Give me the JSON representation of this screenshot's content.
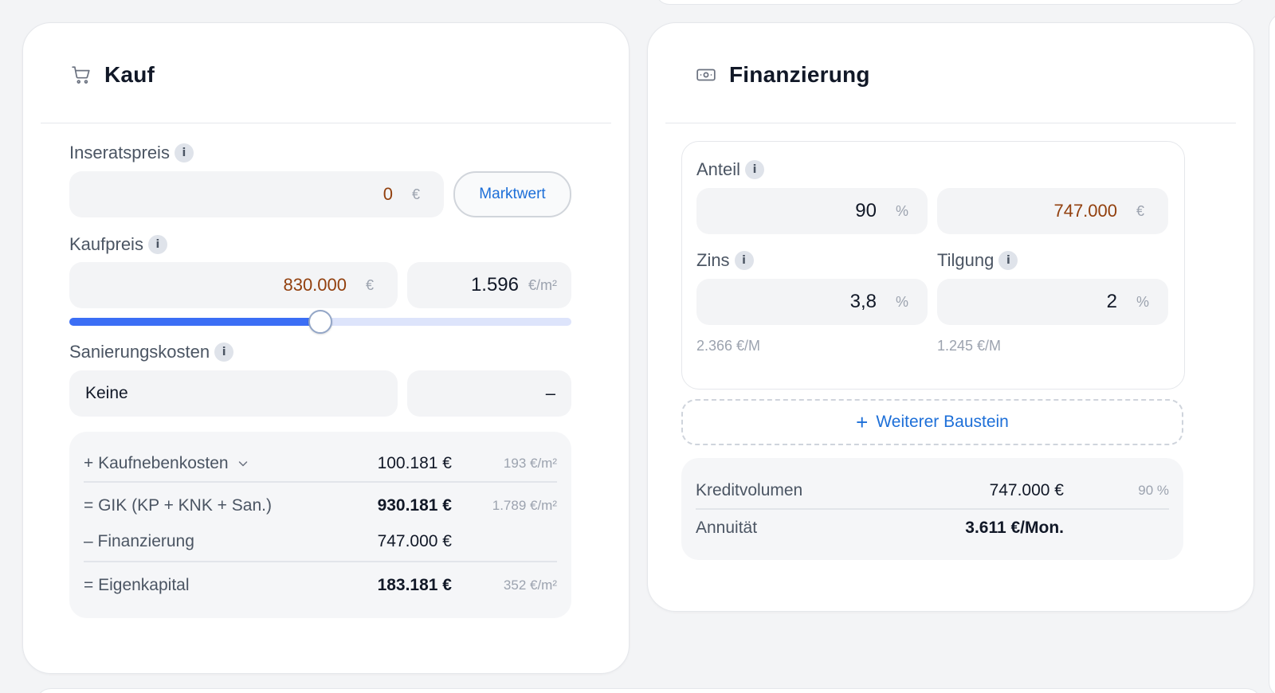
{
  "kauf": {
    "title": "Kauf",
    "inseratspreis": {
      "label": "Inseratspreis",
      "value": "0",
      "unit": "€",
      "button": "Marktwert"
    },
    "kaufpreis": {
      "label": "Kaufpreis",
      "value": "830.000",
      "unit": "€",
      "per_sqm": "1.596",
      "per_sqm_unit": "€/m²",
      "slider_fraction": 0.5
    },
    "sanierung": {
      "label": "Sanierungskosten",
      "value": "Keine",
      "amount": "–"
    },
    "summary": [
      {
        "label": "+ Kaufnebenkosten",
        "value": "100.181 €",
        "per_sqm": "193 €/m²"
      },
      {
        "label": "= GIK (KP + KNK + San.)",
        "value": "930.181 €",
        "per_sqm": "1.789 €/m²"
      },
      {
        "label": "– Finanzierung",
        "value": "747.000 €",
        "per_sqm": ""
      },
      {
        "label": "= Eigenkapital",
        "value": "183.181 €",
        "per_sqm": "352 €/m²"
      }
    ]
  },
  "finanzierung": {
    "title": "Finanzierung",
    "anteil": {
      "label": "Anteil",
      "percent": "90",
      "percent_unit": "%",
      "amount": "747.000",
      "amount_unit": "€"
    },
    "zins": {
      "label": "Zins",
      "value": "3,8",
      "unit": "%",
      "monthly": "2.366 €/M"
    },
    "tilgung": {
      "label": "Tilgung",
      "value": "2",
      "unit": "%",
      "monthly": "1.245 €/M"
    },
    "add_button": "Weiterer Baustein",
    "summary": {
      "kreditvolumen_label": "Kreditvolumen",
      "kreditvolumen_value": "747.000 €",
      "kreditvolumen_percent": "90 %",
      "annuitaet_label": "Annuität",
      "annuitaet_value": "3.611 €/Mon."
    }
  },
  "icons": {
    "kauf": "shopping-cart-icon",
    "finanzierung": "banknote-icon",
    "info": "i",
    "chevron": "chevron-down-icon"
  },
  "colors": {
    "accent": "#1d6fd8",
    "slider": "#3b6ef5",
    "value_brown": "#92400e"
  }
}
